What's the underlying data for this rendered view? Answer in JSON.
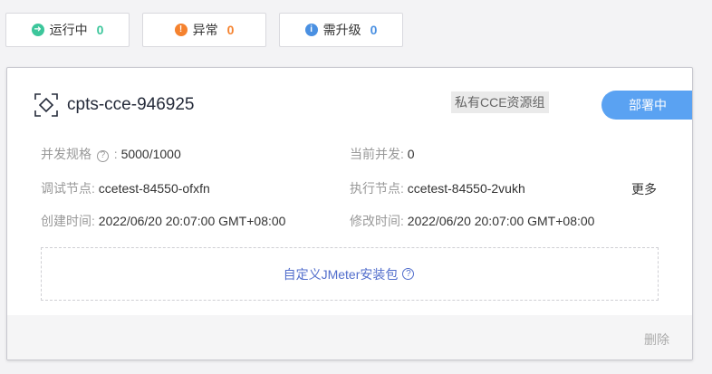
{
  "statusFilters": [
    {
      "label": "运行中",
      "count": "0",
      "icon": "arrow-right-circle-icon",
      "color": "#3cc69b",
      "glyph": "➜"
    },
    {
      "label": "异常",
      "count": "0",
      "icon": "warning-circle-icon",
      "color": "#f5822e",
      "glyph": "!"
    },
    {
      "label": "需升级",
      "count": "0",
      "icon": "info-circle-icon",
      "color": "#4a90e2",
      "glyph": "i"
    }
  ],
  "cluster": {
    "name": "cpts-cce-946925",
    "groupTag": "私有CCE资源组",
    "statusButton": "部署中",
    "concurrencySpecLabel": "并发规格",
    "concurrencySpecSep": " : ",
    "concurrencySpecValue": "5000/1000",
    "currentConcurrencyLabel": "当前并发: ",
    "currentConcurrencyValue": "0",
    "debugNodeLabel": "调试节点: ",
    "debugNodeValue": "ccetest-84550-ofxfn",
    "execNodeLabel": "执行节点: ",
    "execNodeValue": "ccetest-84550-2vukh",
    "more": "更多",
    "createdLabel": "创建时间: ",
    "createdValue": "2022/06/20 20:07:00 GMT+08:00",
    "modifiedLabel": "修改时间: ",
    "modifiedValue": "2022/06/20 20:07:00 GMT+08:00",
    "jmeterLink": "自定义JMeter安装包",
    "deleteLabel": "删除"
  },
  "colors": {
    "accent": "#5aa2f2",
    "link": "#526ecc"
  }
}
